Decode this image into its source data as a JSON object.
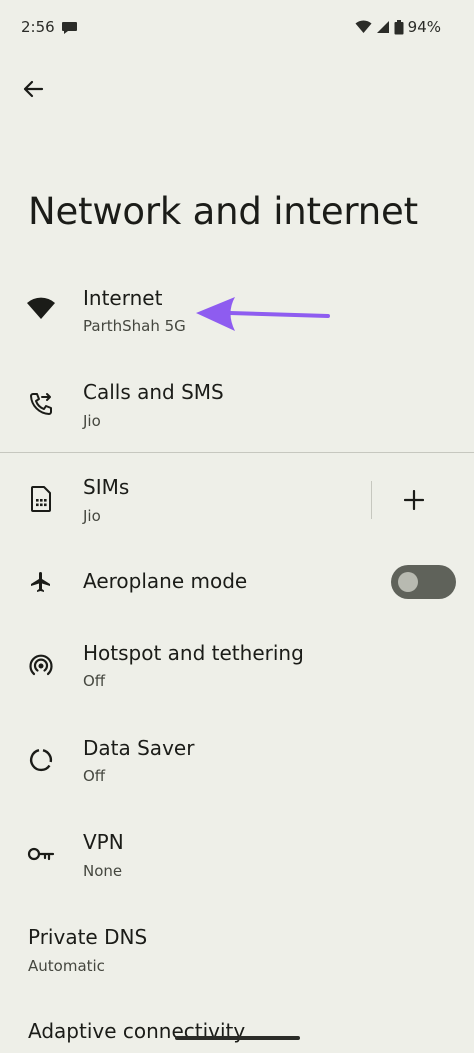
{
  "status_bar": {
    "time": "2:56",
    "battery": "94%"
  },
  "header": {
    "back_icon": "arrow-back-icon",
    "title": "Network and internet"
  },
  "items": [
    {
      "title": "Internet",
      "subtitle": "ParthShah 5G",
      "icon": "wifi-icon"
    },
    {
      "title": "Calls and SMS",
      "subtitle": "Jio",
      "icon": "phone-forward-icon"
    },
    {
      "title": "SIMs",
      "subtitle": "Jio",
      "icon": "sim-card-icon",
      "action": "+"
    },
    {
      "title": "Aeroplane mode",
      "icon": "airplane-icon",
      "toggle": "off"
    },
    {
      "title": "Hotspot and tethering",
      "subtitle": "Off",
      "icon": "hotspot-icon"
    },
    {
      "title": "Data Saver",
      "subtitle": "Off",
      "icon": "data-saver-icon"
    },
    {
      "title": "VPN",
      "subtitle": "None",
      "icon": "vpn-key-icon"
    },
    {
      "title": "Private DNS",
      "subtitle": "Automatic"
    },
    {
      "title": "Adaptive connectivity"
    }
  ],
  "colors": {
    "background": "#eeefe8",
    "annotation_arrow": "#8e5cf0",
    "toggle_track": "#5f625a"
  }
}
